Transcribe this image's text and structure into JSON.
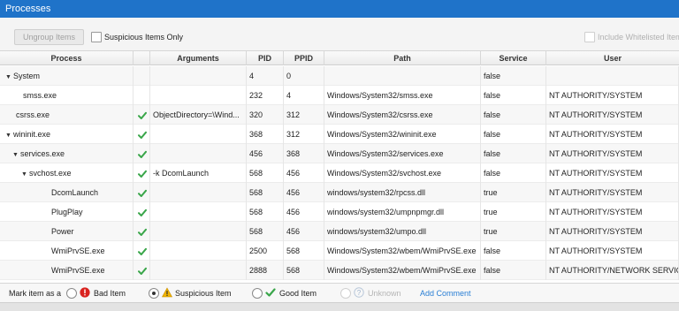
{
  "window": {
    "title": "Processes"
  },
  "toolbar": {
    "ungroup_label": "Ungroup Items",
    "suspicious_only_label": "Suspicious Items Only",
    "whitelisted_label": "Include Whitelisted Item"
  },
  "table": {
    "headers": {
      "process": "Process",
      "flag": "warning-icon",
      "arguments": "Arguments",
      "pid": "PID",
      "ppid": "PPID",
      "path": "Path",
      "service": "Service",
      "user": "User"
    },
    "rows": [
      {
        "process": "System",
        "expanded": true,
        "level": 0,
        "check": false,
        "arguments": "",
        "pid": "4",
        "ppid": "0",
        "path": "",
        "service": "false",
        "user": ""
      },
      {
        "process": "smss.exe",
        "expanded": null,
        "level": 1,
        "check": false,
        "arguments": "",
        "pid": "232",
        "ppid": "4",
        "path": "Windows/System32/smss.exe",
        "service": "false",
        "user": "NT AUTHORITY/SYSTEM"
      },
      {
        "process": "csrss.exe",
        "expanded": null,
        "level": 0,
        "check": true,
        "arguments": "ObjectDirectory=\\Wind...",
        "pid": "320",
        "ppid": "312",
        "path": "Windows/System32/csrss.exe",
        "service": "false",
        "user": "NT AUTHORITY/SYSTEM"
      },
      {
        "process": "wininit.exe",
        "expanded": true,
        "level": 0,
        "check": true,
        "arguments": "",
        "pid": "368",
        "ppid": "312",
        "path": "Windows/System32/wininit.exe",
        "service": "false",
        "user": "NT AUTHORITY/SYSTEM"
      },
      {
        "process": "services.exe",
        "expanded": true,
        "level": 1,
        "check": true,
        "arguments": "",
        "pid": "456",
        "ppid": "368",
        "path": "Windows/System32/services.exe",
        "service": "false",
        "user": "NT AUTHORITY/SYSTEM"
      },
      {
        "process": "svchost.exe",
        "expanded": true,
        "level": 2,
        "check": true,
        "arguments": "-k DcomLaunch",
        "pid": "568",
        "ppid": "456",
        "path": "Windows/System32/svchost.exe",
        "service": "false",
        "user": "NT AUTHORITY/SYSTEM"
      },
      {
        "process": "DcomLaunch",
        "expanded": null,
        "level": 3,
        "check": true,
        "arguments": "",
        "pid": "568",
        "ppid": "456",
        "path": "windows/system32/rpcss.dll",
        "service": "true",
        "user": "NT AUTHORITY/SYSTEM"
      },
      {
        "process": "PlugPlay",
        "expanded": null,
        "level": 3,
        "check": true,
        "arguments": "",
        "pid": "568",
        "ppid": "456",
        "path": "windows/system32/umpnpmgr.dll",
        "service": "true",
        "user": "NT AUTHORITY/SYSTEM"
      },
      {
        "process": "Power",
        "expanded": null,
        "level": 3,
        "check": true,
        "arguments": "",
        "pid": "568",
        "ppid": "456",
        "path": "windows/system32/umpo.dll",
        "service": "true",
        "user": "NT AUTHORITY/SYSTEM"
      },
      {
        "process": "WmiPrvSE.exe",
        "expanded": null,
        "level": 3,
        "check": true,
        "arguments": "",
        "pid": "2500",
        "ppid": "568",
        "path": "Windows/System32/wbem/WmiPrvSE.exe",
        "service": "false",
        "user": "NT AUTHORITY/SYSTEM"
      },
      {
        "process": "WmiPrvSE.exe",
        "expanded": null,
        "level": 3,
        "check": true,
        "arguments": "",
        "pid": "2888",
        "ppid": "568",
        "path": "Windows/System32/wbem/WmiPrvSE.exe",
        "service": "false",
        "user": "NT AUTHORITY/NETWORK SERVICE"
      }
    ]
  },
  "footer": {
    "mark_label": "Mark item as a",
    "bad_label": "Bad Item",
    "suspicious_label": "Suspicious Item",
    "good_label": "Good Item",
    "unknown_label": "Unknown",
    "add_comment_label": "Add Comment",
    "selected": "suspicious"
  },
  "colors": {
    "titlebar": "#1f73c9",
    "check": "#3aa64a",
    "warning": "#f0b400",
    "bad": "#d9231f",
    "link": "#2a7fd4"
  }
}
